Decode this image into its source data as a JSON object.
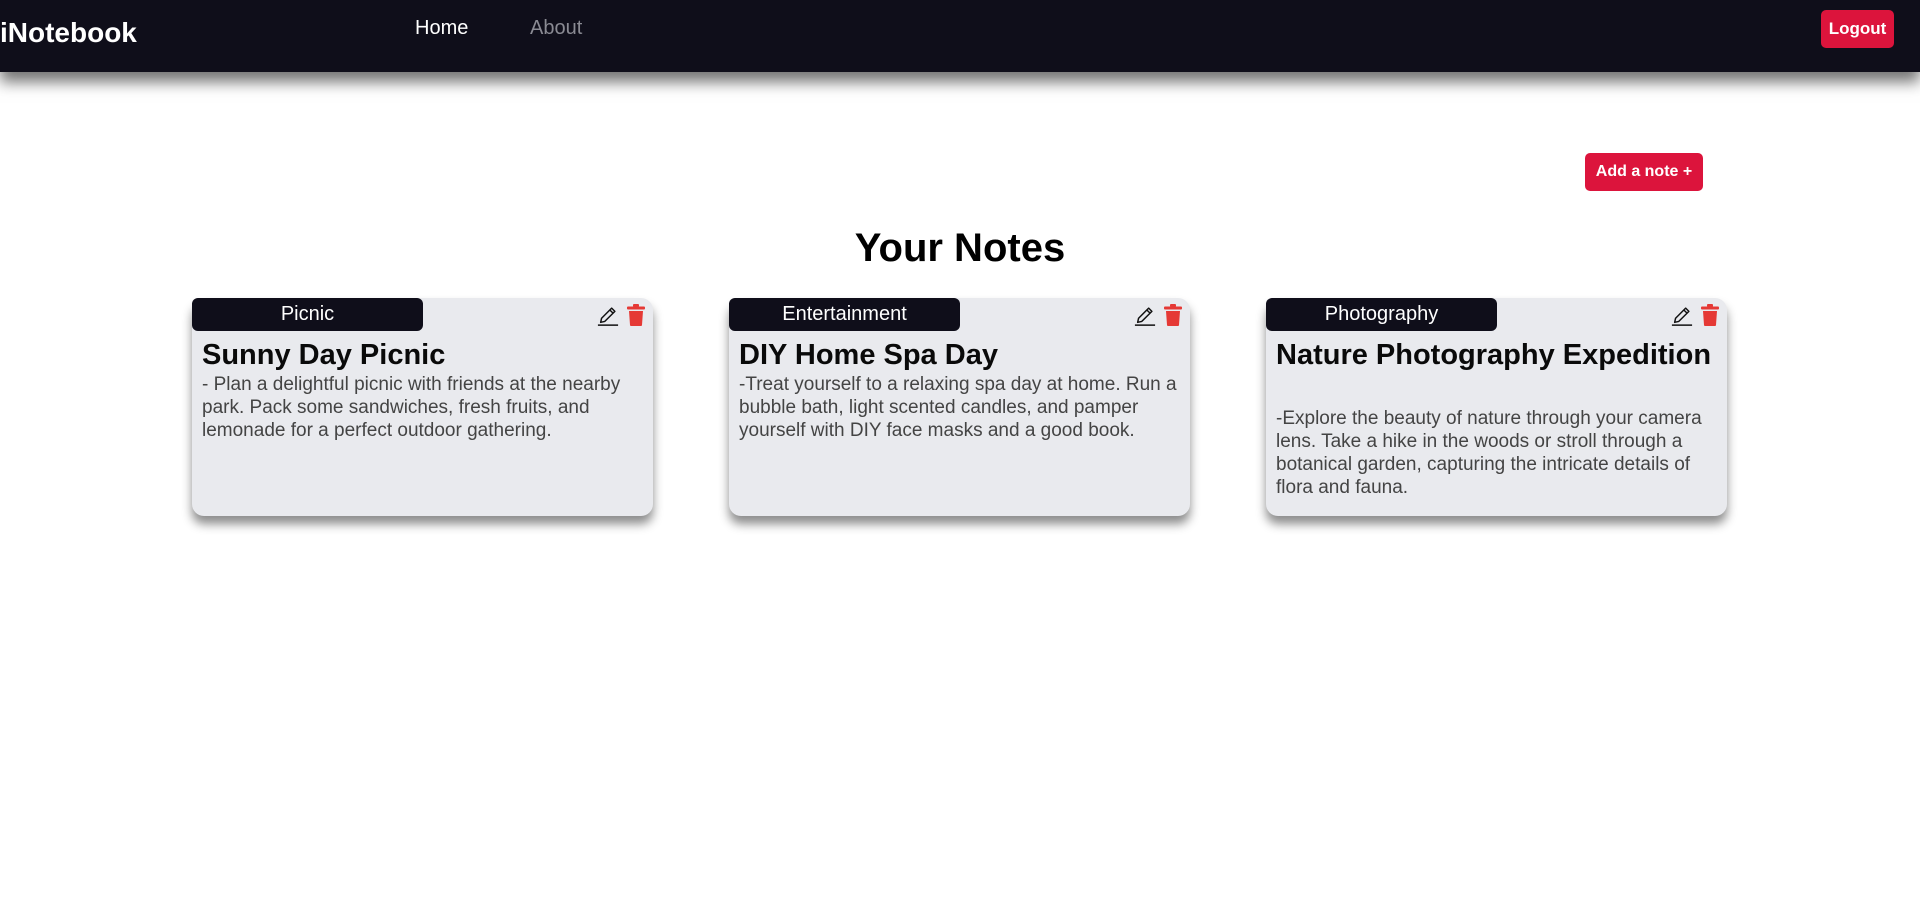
{
  "navbar": {
    "brand": "iNotebook",
    "links": [
      {
        "label": "Home"
      },
      {
        "label": "About"
      }
    ],
    "logout_label": "Logout"
  },
  "add_note_label": "Add a note +",
  "page_title": "Your Notes",
  "notes": [
    {
      "tag": "Picnic",
      "title": "Sunny Day Picnic",
      "description": "- Plan a delightful picnic with friends at the nearby park. Pack some sandwiches, fresh fruits, and lemonade for a perfect outdoor gathering."
    },
    {
      "tag": "Entertainment",
      "title": "DIY Home Spa Day",
      "description": "-Treat yourself to a relaxing spa day at home. Run a bubble bath, light scented candles, and pamper yourself with DIY face masks and a good book."
    },
    {
      "tag": "Photography",
      "title": "Nature Photography Expedition",
      "description": "-Explore the beauty of nature through your camera lens. Take a hike in the woods or stroll through a botanical garden, capturing the intricate details of flora and fauna."
    }
  ],
  "icons": {
    "edit": "pencil-icon",
    "delete": "trash-icon"
  },
  "colors": {
    "navbar_bg": "#0f0e1a",
    "accent": "#dc143c",
    "card_bg": "#e9eaee",
    "delete_icon": "#e53935"
  }
}
